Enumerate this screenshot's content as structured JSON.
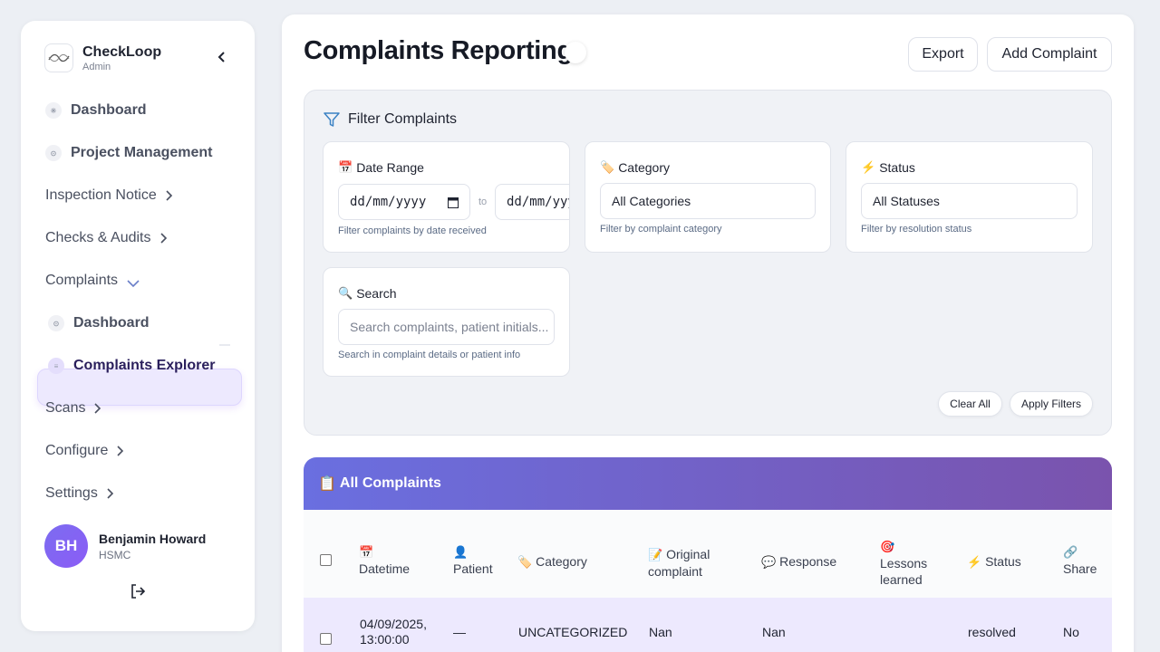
{
  "brand": {
    "name": "CheckLoop",
    "role": "Admin"
  },
  "nav": {
    "dashboard": "Dashboard",
    "project_management": "Project Management",
    "inspection_notice": "Inspection Notice",
    "checks_audits": "Checks & Audits",
    "complaints": "Complaints",
    "complaints_dashboard": "Dashboard",
    "complaints_explorer": "Complaints Explorer",
    "scans": "Scans",
    "configure": "Configure",
    "settings": "Settings"
  },
  "user": {
    "initials": "BH",
    "name": "Benjamin Howard",
    "org": "HSMC"
  },
  "page": {
    "title": "Complaints Reporting",
    "export_label": "Export",
    "add_label": "Add Complaint"
  },
  "filter": {
    "title": "Filter Complaints",
    "date": {
      "label": "Date Range",
      "from_value": "dd/mm/yyyy",
      "to_sep": "to",
      "to_value": "dd/mm/yyyy",
      "help": "Filter complaints by date received"
    },
    "category": {
      "label": "Category",
      "value": "All Categories",
      "help": "Filter by complaint category"
    },
    "status": {
      "label": "Status",
      "value": "All Statuses",
      "help": "Filter by resolution status"
    },
    "search": {
      "label": "Search",
      "placeholder": "Search complaints, patient initials...",
      "help": "Search in complaint details or patient info"
    },
    "clear_label": "Clear All",
    "apply_label": "Apply Filters"
  },
  "table": {
    "title": "All Complaints",
    "headers": {
      "datetime": "Datetime",
      "patient": "Patient",
      "category": "Category",
      "original_1": "Original",
      "original_2": "complaint",
      "response": "Response",
      "lessons_1": "Lessons",
      "lessons_2": "learned",
      "status": "Status",
      "share": "Share"
    },
    "rows": [
      {
        "date": "04/09/2025,",
        "time": "13:00:00",
        "patient": "—",
        "category": "UNCATEGORIZED",
        "original": "Nan",
        "response": "Nan",
        "lessons": "",
        "status": "resolved",
        "share": "No"
      }
    ]
  },
  "colors": {
    "accent": "#7c3aed",
    "header_gradient_start": "#6a6fe0",
    "header_gradient_end": "#7a53ad",
    "active_bg": "#ede9fe"
  }
}
